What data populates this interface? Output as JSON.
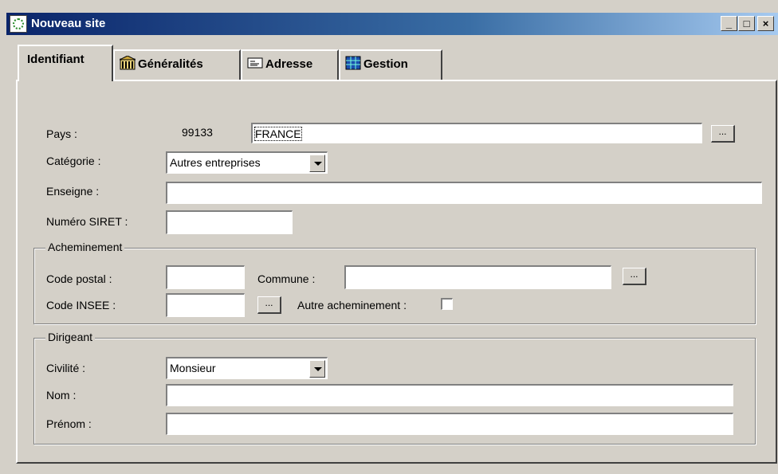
{
  "window": {
    "title": "Nouveau site",
    "controls": {
      "minimize": "_",
      "maximize": "□",
      "close": "×"
    }
  },
  "tabs": [
    {
      "label": "Identifiant",
      "icon": "none",
      "active": true
    },
    {
      "label": "Généralités",
      "icon": "building-icon",
      "active": false
    },
    {
      "label": "Adresse",
      "icon": "address-card-icon",
      "active": false
    },
    {
      "label": "Gestion",
      "icon": "grid-icon",
      "active": false
    }
  ],
  "form": {
    "pays": {
      "label": "Pays :",
      "code": "99133",
      "value": "FRANCE",
      "browse": "..."
    },
    "categorie": {
      "label": "Catégorie :",
      "value": "Autres entreprises"
    },
    "enseigne": {
      "label": "Enseigne :",
      "value": ""
    },
    "siret": {
      "label": "Numéro SIRET :",
      "value": ""
    }
  },
  "acheminement": {
    "title": "Acheminement",
    "code_postal": {
      "label": "Code postal :",
      "value": ""
    },
    "commune": {
      "label": "Commune :",
      "value": "",
      "browse": "..."
    },
    "code_insee": {
      "label": "Code INSEE :",
      "value": "",
      "browse": "..."
    },
    "autre": {
      "label": "Autre acheminement :",
      "checked": false
    }
  },
  "dirigeant": {
    "title": "Dirigeant",
    "civilite": {
      "label": "Civilité :",
      "value": "Monsieur"
    },
    "nom": {
      "label": "Nom :",
      "value": ""
    },
    "prenom": {
      "label": "Prénom :",
      "value": ""
    }
  }
}
